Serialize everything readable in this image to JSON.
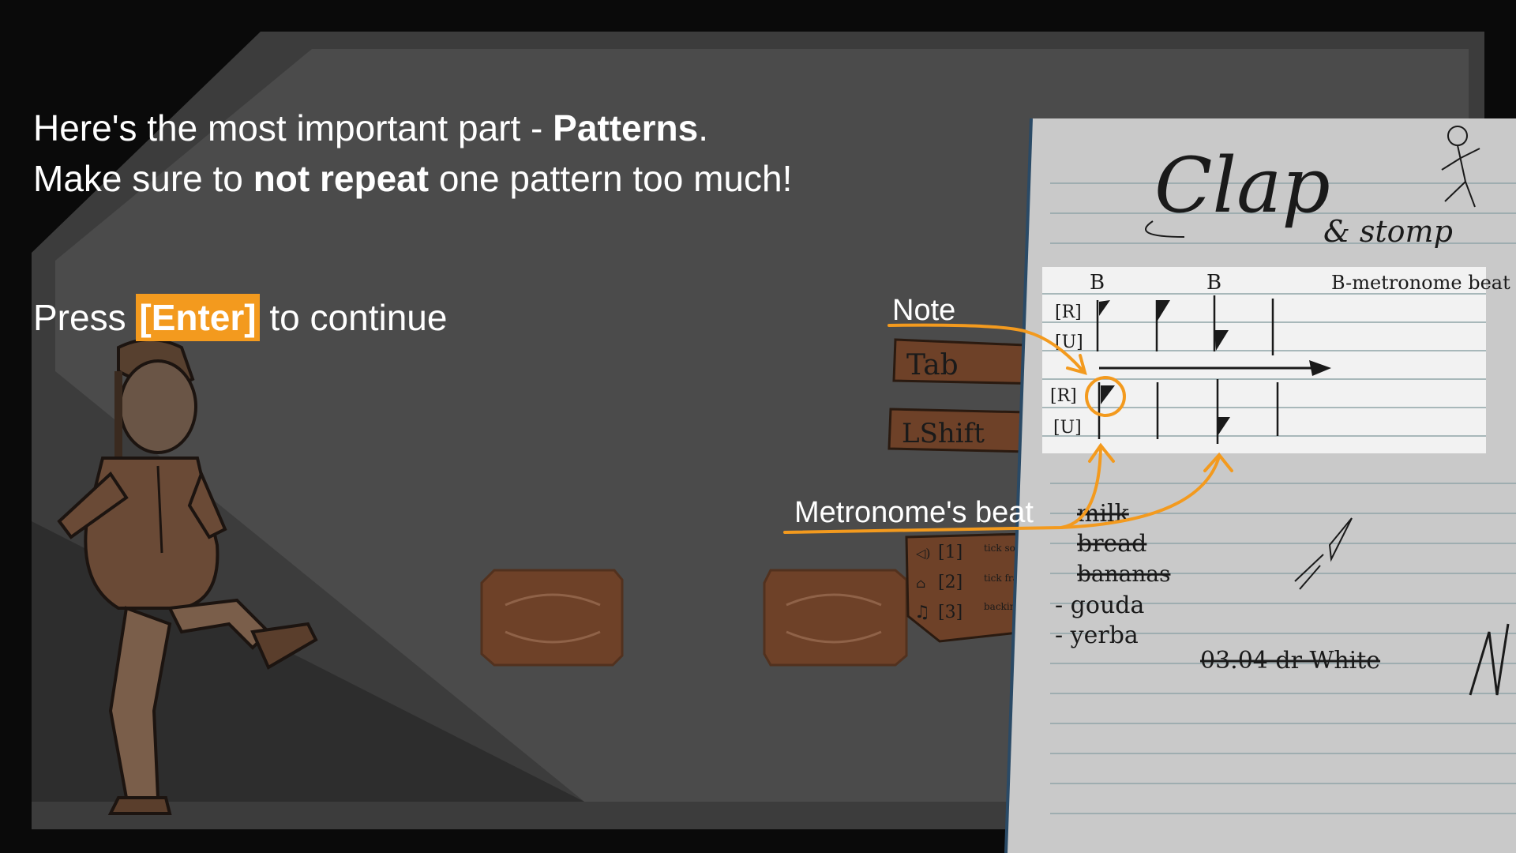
{
  "tutorial": {
    "line1_pre": "Here's the most important part - ",
    "line1_bold": "Patterns",
    "line1_post": ".",
    "line2_pre": "Make sure to ",
    "line2_bold": "not repeat",
    "line2_post": " one pattern too much!",
    "press_pre": "Press ",
    "press_key": "[Enter]",
    "press_post": " to continue"
  },
  "annotations": {
    "note_label": "Note",
    "metronome_label": "Metronome's beat"
  },
  "keys": {
    "tab": "Tab",
    "lshift": "LShift"
  },
  "notebook": {
    "title": "Clap",
    "subtitle": "& stomp",
    "beat_marker": "B",
    "beat_legend": "B-metronome beat",
    "row_r": "[R]",
    "row_u": "[U]",
    "shopping_list": [
      "milk",
      "bread",
      "bananas",
      "- gouda",
      "- yerba"
    ],
    "footer_note": "03.04 dr White"
  },
  "legend": [
    {
      "key": "[1]",
      "desc": "tick sound",
      "icon": "speaker-icon"
    },
    {
      "key": "[2]",
      "desc": "tick frame",
      "icon": "lamp-icon"
    },
    {
      "key": "[3]",
      "desc": "backing track",
      "icon": "music-note-icon"
    }
  ],
  "colors": {
    "accent": "#f39a1e",
    "frame_bg": "#4a4a4a",
    "outer_bg": "#0a0a0a",
    "pad": "#6e4128",
    "paper": "#c9c9c9"
  }
}
